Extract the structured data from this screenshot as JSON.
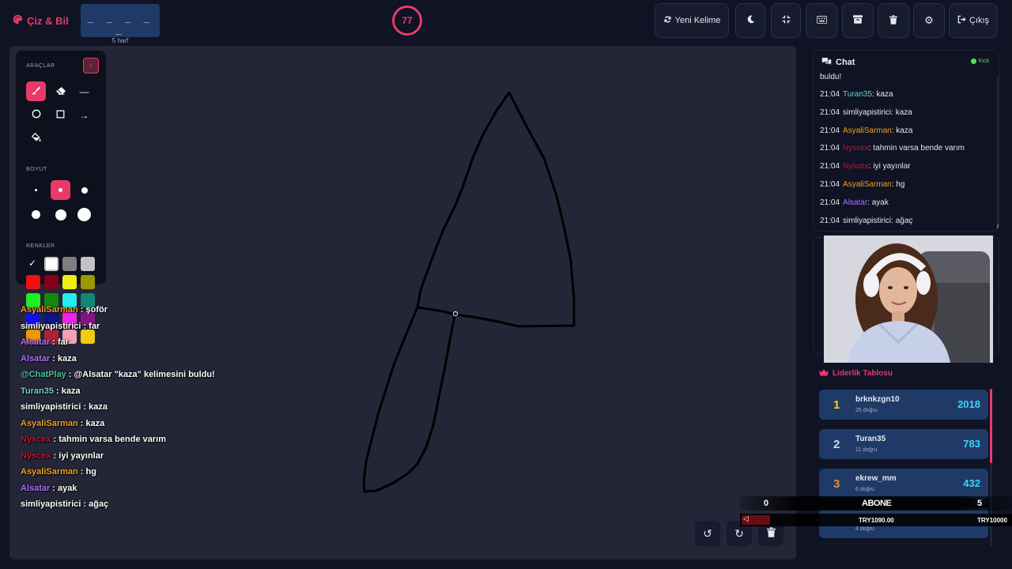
{
  "header": {
    "app_name": "Çiz & Bil",
    "word_mask": "_ _ _ _ _",
    "word_length": "5 harf",
    "timer": "77",
    "new_word_label": "Yeni Kelime",
    "exit_label": "Çıkış"
  },
  "toolbar": {
    "tools_label": "ARAÇLAR",
    "size_label": "BOYUT",
    "colors_label": "RENKLER",
    "colors": [
      "#000000",
      "#ffffff",
      "#7f7f7f",
      "#c3c3c3",
      "#ee1111",
      "#880015",
      "#eeee11",
      "#999900",
      "#22ee22",
      "#118811",
      "#22eeee",
      "#118877",
      "#1111ee",
      "#111188",
      "#ee22ee",
      "#881188",
      "#ee9900",
      "#aa2233",
      "#f2a0b4",
      "#eecc11"
    ]
  },
  "overlay_chat": [
    {
      "user": "AsyaliSarman",
      "text": ": şoför",
      "color": "#f0a020"
    },
    {
      "user": "simliyapistirici",
      "text": ": far",
      "color": "#ffffff"
    },
    {
      "user": "Alsatar",
      "text": ": far",
      "color": "#b070ff"
    },
    {
      "user": "Alsatar",
      "text": ": kaza",
      "color": "#b070ff"
    },
    {
      "user": "@ChatPlay",
      "text": ": @Alsatar \"kaza\" kelimesini buldu!",
      "color": "#53c2a0"
    },
    {
      "user": "Turan35",
      "text": ": kaza",
      "color": "#6ed0d0"
    },
    {
      "user": "simliyapistirici",
      "text": ": kaza",
      "color": "#ffffff"
    },
    {
      "user": "AsyaliSarman",
      "text": ": kaza",
      "color": "#f0a020"
    },
    {
      "user": "Nyscex",
      "text": ": tahmin varsa bende varım",
      "color": "#cc1133"
    },
    {
      "user": "Nyscex",
      "text": ": iyi yayınlar",
      "color": "#cc1133"
    },
    {
      "user": "AsyaliSarman",
      "text": ": hg",
      "color": "#f0a020"
    },
    {
      "user": "Alsatar",
      "text": ": ayak",
      "color": "#b070ff"
    },
    {
      "user": "simliyapistirici",
      "text": ": ağaç",
      "color": "#ffffff"
    }
  ],
  "chat": {
    "title": "Chat",
    "platform": "Kick",
    "top_fragment": "buldu!",
    "messages": [
      {
        "time": "21:04",
        "user": "Turan35",
        "text": ": kaza",
        "color": "#6ed0d0"
      },
      {
        "time": "21:04",
        "user": "simliyapistirici",
        "text": ": kaza",
        "color": "#e6e8f0"
      },
      {
        "time": "21:04",
        "user": "AsyaliSarman",
        "text": ": kaza",
        "color": "#f0a020"
      },
      {
        "time": "21:04",
        "user": "Nyscex",
        "text": ": tahmin varsa bende varım",
        "color": "#cc1133"
      },
      {
        "time": "21:04",
        "user": "Nyscex",
        "text": ": iyi yayınlar",
        "color": "#cc1133"
      },
      {
        "time": "21:04",
        "user": "AsyaliSarman",
        "text": ": hg",
        "color": "#f0a020"
      },
      {
        "time": "21:04",
        "user": "Alsatar",
        "text": ": ayak",
        "color": "#b070ff"
      },
      {
        "time": "21:04",
        "user": "simliyapistirici",
        "text": ": ağaç",
        "color": "#e6e8f0"
      }
    ]
  },
  "leaderboard": {
    "title": "Liderlik Tablosu",
    "rows": [
      {
        "rank": "1",
        "name": "brknkzgn10",
        "sub": "25 doğru",
        "score": "2018",
        "rank_color": "#f5d020"
      },
      {
        "rank": "2",
        "name": "Turan35",
        "sub": "11 doğru",
        "score": "783",
        "rank_color": "#d0d6e2"
      },
      {
        "rank": "3",
        "name": "ekrew_mm",
        "sub": "6 doğru",
        "score": "432",
        "rank_color": "#e08a3a"
      },
      {
        "rank": "",
        "name": "",
        "sub": "4 doğru",
        "score": "",
        "rank_color": "#d0d6e2"
      }
    ]
  },
  "sub_overlay": {
    "left_count": "0",
    "title": "ABONE",
    "right_count": "5",
    "left_amount": "TRY1090.00",
    "right_amount": "TRY10000"
  }
}
